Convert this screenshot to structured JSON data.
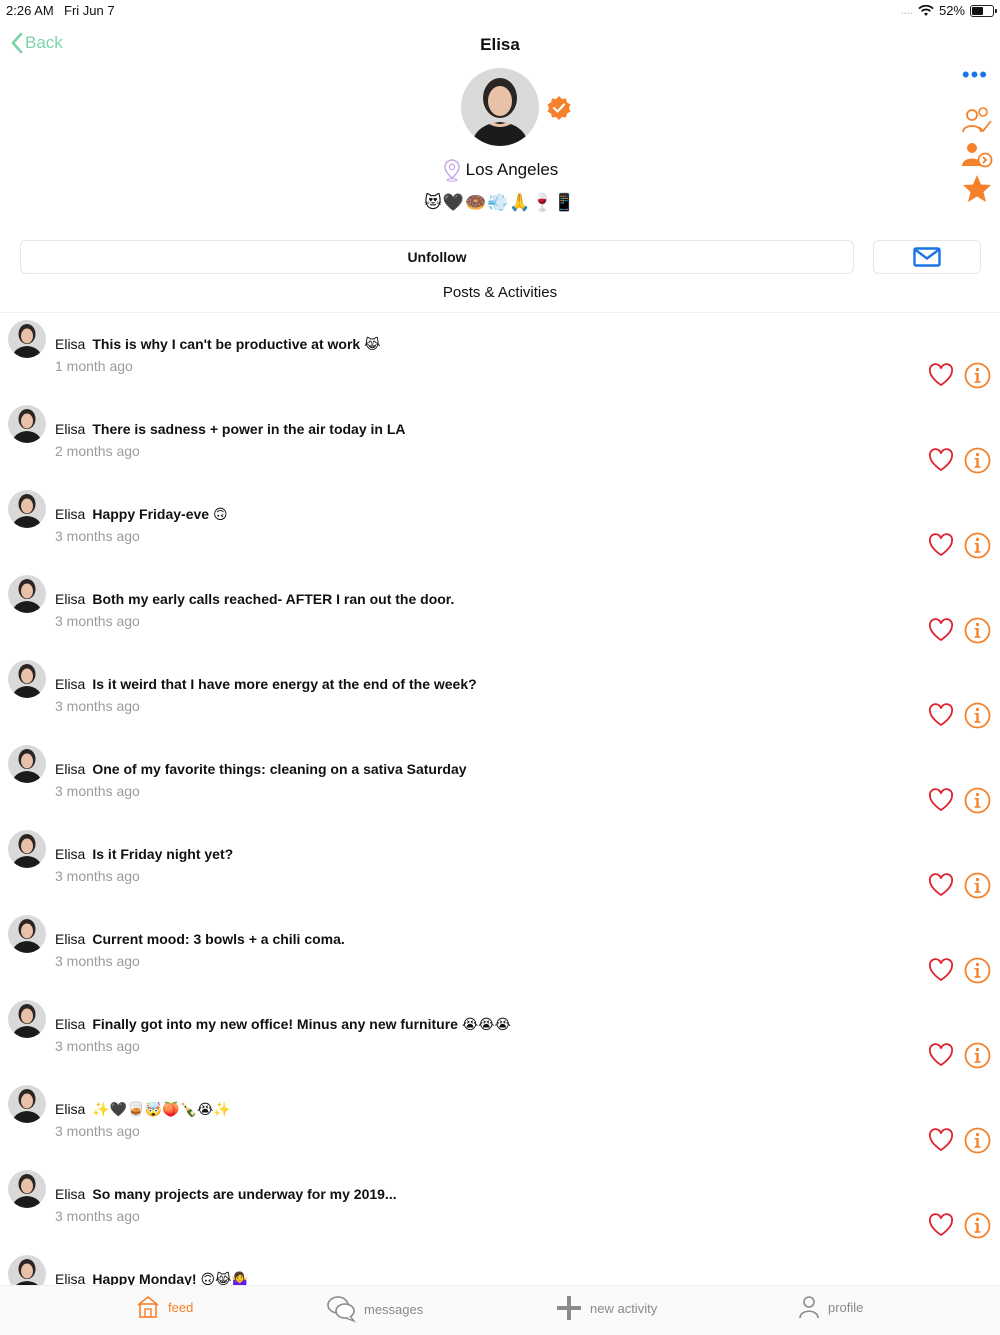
{
  "status": {
    "time": "2:26 AM",
    "date": "Fri Jun 7",
    "battery": "52%",
    "signal_dots": "...."
  },
  "nav": {
    "back_label": "Back",
    "title": "Elisa",
    "more_label": "•••"
  },
  "profile": {
    "location": "Los Angeles",
    "emojis": "😻🖤🍩💨🙏🍷📱"
  },
  "actions": {
    "unfollow_label": "Unfollow"
  },
  "section_title": "Posts & Activities",
  "posts": [
    {
      "name": "Elisa",
      "text": "This is why I can't be productive at work 😹",
      "time": "1 month ago"
    },
    {
      "name": "Elisa",
      "text": "There is sadness + power in the air today in LA",
      "time": "2 months ago"
    },
    {
      "name": "Elisa",
      "text": "Happy Friday-eve 🙃",
      "time": "3 months ago"
    },
    {
      "name": "Elisa",
      "text": "Both my early calls reached- AFTER I ran out the door.",
      "time": "3 months ago"
    },
    {
      "name": "Elisa",
      "text": "Is it weird that I have more energy at the end of the week?",
      "time": "3 months ago"
    },
    {
      "name": "Elisa",
      "text": "One of my favorite things: cleaning on a sativa Saturday",
      "time": "3 months ago"
    },
    {
      "name": "Elisa",
      "text": "Is it Friday night yet?",
      "time": "3 months ago"
    },
    {
      "name": "Elisa",
      "text": "Current mood: 3 bowls + a chili coma.",
      "time": "3 months ago"
    },
    {
      "name": "Elisa",
      "text": "Finally got into my new office! Minus any new furniture 😭😭😭",
      "time": "3 months ago"
    },
    {
      "name": "Elisa",
      "text": "✨🖤🥃🤯🍑🍾😭✨",
      "time": "3 months ago"
    },
    {
      "name": "Elisa",
      "text": "So many projects are underway for my 2019...",
      "time": "3 months ago"
    },
    {
      "name": "Elisa",
      "text": "Happy Monday! 🙃😹🤷‍♀️",
      "time": ""
    }
  ],
  "tabs": {
    "feed": "feed",
    "messages": "messages",
    "new_activity": "new activity",
    "profile": "profile"
  },
  "colors": {
    "accent": "#f5822a",
    "back": "#7dd3a8",
    "link": "#1a73e8",
    "heart": "#e0222e",
    "muted": "#9b9b9b"
  },
  "icons": {
    "back": "chevron-left-icon",
    "more": "ellipsis-icon",
    "verified": "verified-badge-icon",
    "location": "location-pin-icon",
    "mail": "mail-icon",
    "heart": "heart-icon",
    "info": "info-icon",
    "side": [
      "follow-check-icon",
      "share-user-icon",
      "star-icon"
    ],
    "tabs": [
      "home-icon",
      "chat-bubbles-icon",
      "plus-icon",
      "person-icon"
    ]
  }
}
